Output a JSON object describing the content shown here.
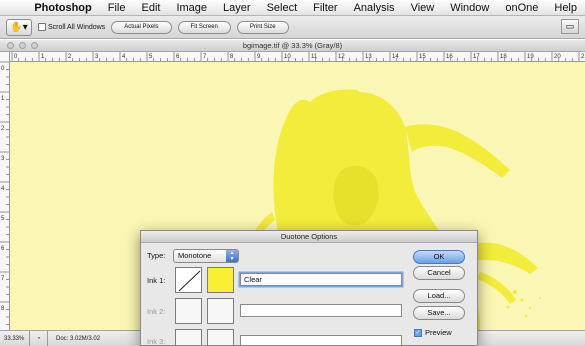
{
  "menubar": {
    "apple_glyph": "",
    "items": [
      "Photoshop",
      "File",
      "Edit",
      "Image",
      "Layer",
      "Select",
      "Filter",
      "Analysis",
      "View",
      "Window",
      "onOne",
      "Help"
    ]
  },
  "options_bar": {
    "scroll_all_windows": "Scroll All Windows",
    "actual_pixels": "Actual Pixels",
    "fit_screen": "Fit Screen",
    "print_size": "Print Size"
  },
  "document": {
    "title": "bgimage.tif @ 33.3% (Gray/8)",
    "ruler_ticks": [
      "0",
      "1",
      "2",
      "3",
      "4",
      "5",
      "6",
      "7",
      "8",
      "9",
      "10",
      "11",
      "12",
      "13",
      "14",
      "15",
      "16",
      "17",
      "18",
      "19",
      "20",
      "21"
    ],
    "vruler_ticks": [
      "0",
      "1",
      "2",
      "3",
      "4",
      "5",
      "6",
      "7",
      "8"
    ],
    "zoom": "33.33%",
    "doc_size": "Doc: 3.02M/3.02"
  },
  "dialog": {
    "title": "Duotone Options",
    "type_label": "Type:",
    "type_value": "Monotone",
    "inks": [
      {
        "label": "Ink 1:",
        "name": "Clear",
        "enabled": true
      },
      {
        "label": "Ink 2:",
        "name": "",
        "enabled": false
      },
      {
        "label": "Ink 3:",
        "name": "",
        "enabled": false
      }
    ],
    "buttons": {
      "ok": "OK",
      "cancel": "Cancel",
      "load": "Load...",
      "save": "Save..."
    },
    "preview_label": "Preview",
    "preview_checked": true
  },
  "colors": {
    "canvas": "#faf7b4",
    "figure": "#f2ec3a",
    "ink1": "#f7ef30"
  }
}
